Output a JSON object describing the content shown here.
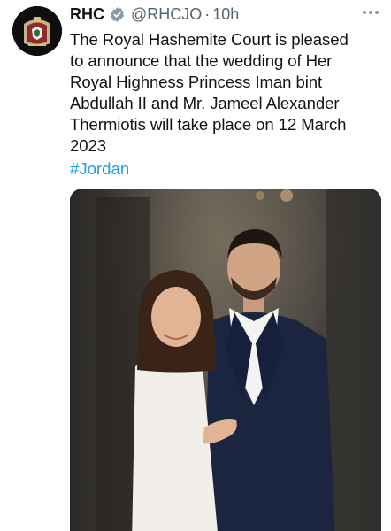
{
  "tweet": {
    "display_name": "RHC",
    "handle": "@RHCJO",
    "separator": "·",
    "time": "10h",
    "text_lines": [
      "The Royal Hashemite Court is pleased",
      "to announce that the wedding of Her",
      "Royal Highness Princess Iman bint",
      "Abdullah II and Mr. Jameel Alexander",
      "Thermiotis will take place on 12 March",
      "2023"
    ],
    "hashtag": "#Jordan"
  },
  "icons": {
    "avatar": "royal-coat-of-arms",
    "verified": "verified-badge-icon",
    "more": "more-options-icon"
  },
  "colors": {
    "link": "#1d9bf0",
    "secondary_text": "#536471",
    "verified_badge": "#829aab"
  }
}
